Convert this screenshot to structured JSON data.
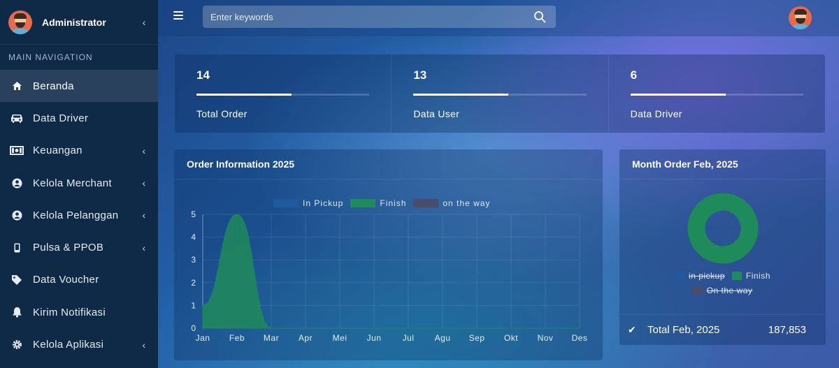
{
  "sidebar": {
    "username": "Administrator",
    "nav_header": "MAIN NAVIGATION",
    "items": [
      {
        "label": "Beranda",
        "icon": "home-icon",
        "active": true,
        "has_chevron": false
      },
      {
        "label": "Data Driver",
        "icon": "car-icon",
        "active": false,
        "has_chevron": false
      },
      {
        "label": "Keuangan",
        "icon": "money-icon",
        "active": false,
        "has_chevron": true
      },
      {
        "label": "Kelola Merchant",
        "icon": "user-circle-icon",
        "active": false,
        "has_chevron": true
      },
      {
        "label": "Kelola Pelanggan",
        "icon": "user-circle-icon",
        "active": false,
        "has_chevron": true
      },
      {
        "label": "Pulsa & PPOB",
        "icon": "mobile-icon",
        "active": false,
        "has_chevron": true
      },
      {
        "label": "Data Voucher",
        "icon": "tag-icon",
        "active": false,
        "has_chevron": false
      },
      {
        "label": "Kirim Notifikasi",
        "icon": "bell-icon",
        "active": false,
        "has_chevron": false
      },
      {
        "label": "Kelola Aplikasi",
        "icon": "gear-icon",
        "active": false,
        "has_chevron": true
      }
    ]
  },
  "topbar": {
    "search_placeholder": "Enter keywords"
  },
  "stats": [
    {
      "value": "14",
      "label": "Total Order",
      "progress": 0.55
    },
    {
      "value": "13",
      "label": "Data User",
      "progress": 0.55
    },
    {
      "value": "6",
      "label": "Data Driver",
      "progress": 0.55
    }
  ],
  "order_card": {
    "title": "Order Information 2025"
  },
  "month_card": {
    "title": "Month Order Feb, 2025",
    "legend": [
      {
        "label": "in pickup",
        "color": "#1f5aa0",
        "hidden": true
      },
      {
        "label": "Finish",
        "color": "#1f8a5a",
        "hidden": false
      },
      {
        "label": "On the way",
        "color": "#4a4a6a",
        "hidden": true
      }
    ],
    "total_label": "Total Feb, 2025",
    "total_value": "187,853"
  },
  "colors": {
    "in_pickup": "#1f5aa0",
    "finish": "#1f8a5a",
    "on_the_way": "#4a4a6a"
  },
  "chart_data": [
    {
      "type": "area",
      "title": "Order Information 2025",
      "categories": [
        "Jan",
        "Feb",
        "Mar",
        "Apr",
        "Mei",
        "Jun",
        "Jul",
        "Agu",
        "Sep",
        "Okt",
        "Nov",
        "Des"
      ],
      "series": [
        {
          "name": "In Pickup",
          "values": [
            0,
            0,
            0,
            0,
            0,
            0,
            0,
            0,
            0,
            0,
            0,
            0
          ]
        },
        {
          "name": "Finish",
          "values": [
            1,
            5,
            0,
            0,
            0,
            0,
            0,
            0,
            0,
            0,
            0,
            0
          ]
        },
        {
          "name": "on the way",
          "values": [
            0,
            0,
            0,
            0,
            0,
            0,
            0,
            0,
            0,
            0,
            0,
            0
          ]
        }
      ],
      "ylim": [
        0,
        5
      ],
      "yticks": [
        "0",
        "1",
        "2",
        "3",
        "4",
        "5"
      ],
      "legend_position": "top",
      "grid": true
    },
    {
      "type": "pie",
      "title": "Month Order Feb, 2025",
      "labels": [
        "in pickup",
        "Finish",
        "On the way"
      ],
      "values": [
        0,
        1,
        0
      ],
      "donut": true
    }
  ]
}
